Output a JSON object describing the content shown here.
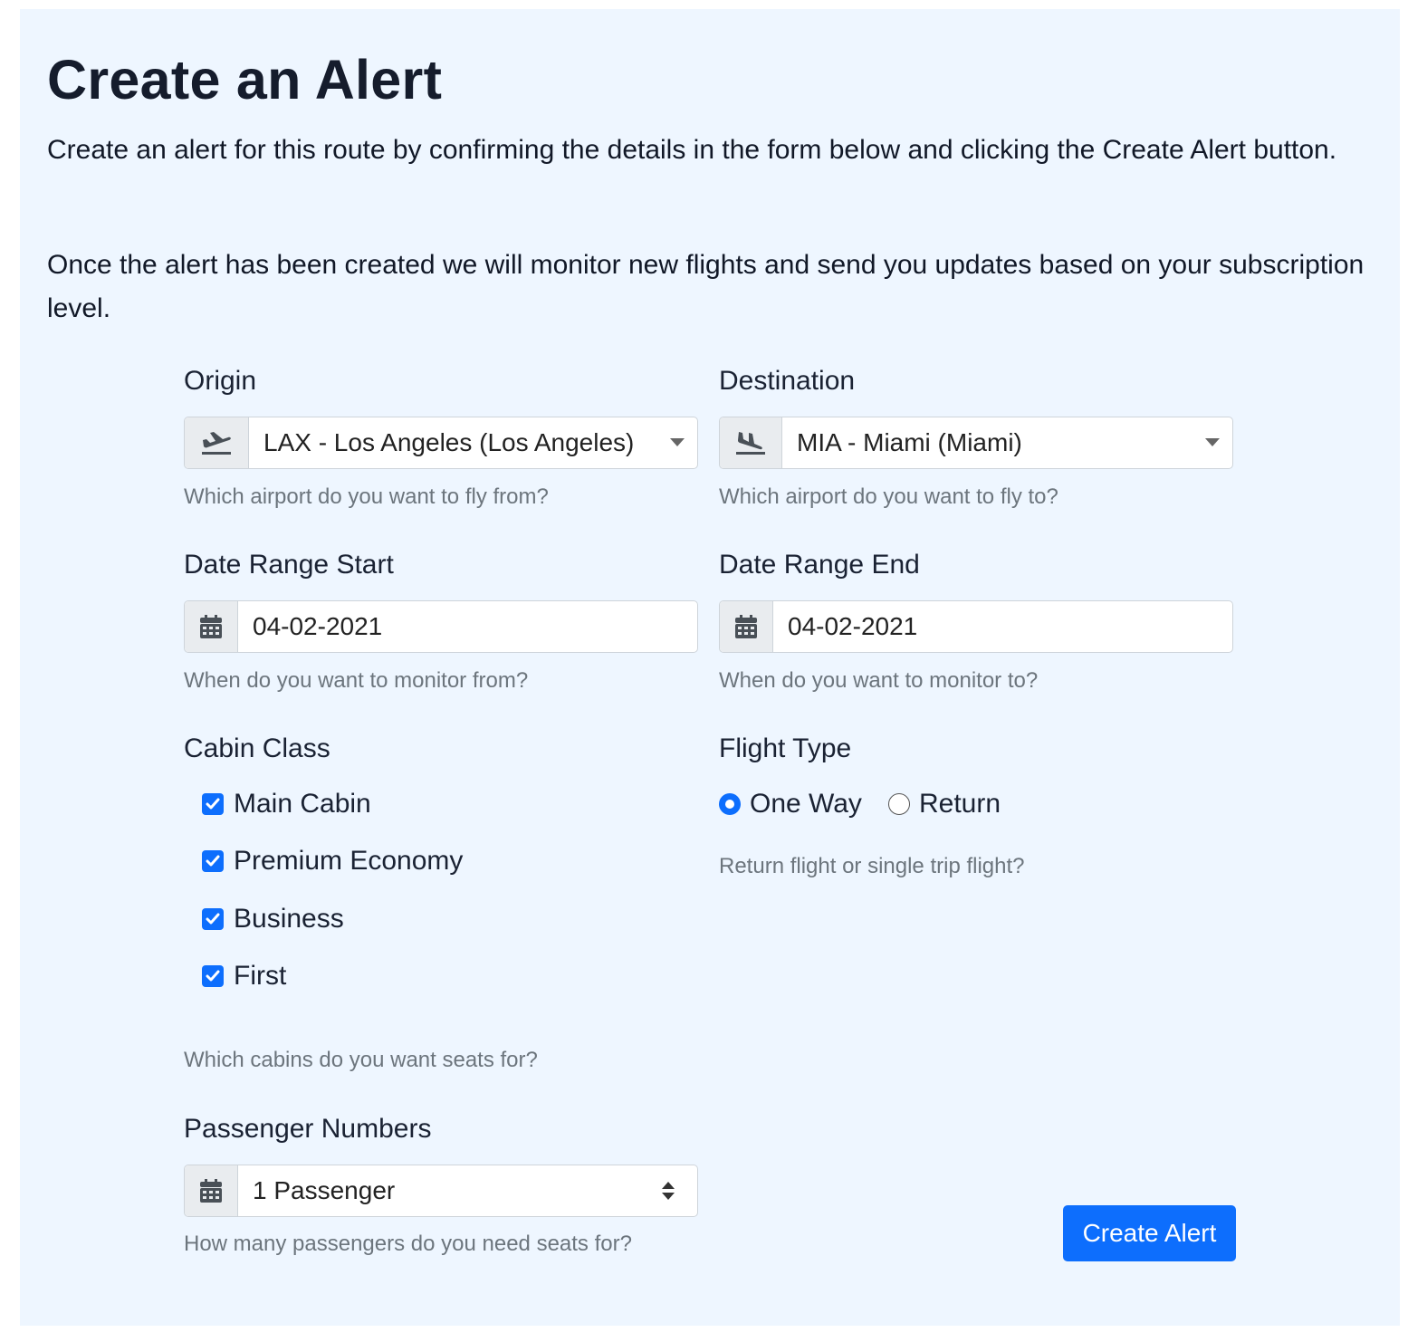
{
  "page": {
    "title": "Create an Alert",
    "intro_1": "Create an alert for this route by confirming the details in the form below and clicking the Create Alert button.",
    "intro_2": "Once the alert has been created we will monitor new flights and send you updates based on your subscription level."
  },
  "origin": {
    "label": "Origin",
    "icon": "plane-departure-icon",
    "value": "LAX - Los Angeles (Los Angeles)",
    "help": "Which airport do you want to fly from?"
  },
  "destination": {
    "label": "Destination",
    "icon": "plane-arrival-icon",
    "value": "MIA - Miami (Miami)",
    "help": "Which airport do you want to fly to?"
  },
  "date_start": {
    "label": "Date Range Start",
    "icon": "calendar-icon",
    "value": "04-02-2021",
    "help": "When do you want to monitor from?"
  },
  "date_end": {
    "label": "Date Range End",
    "icon": "calendar-icon",
    "value": "04-02-2021",
    "help": "When do you want to monitor to?"
  },
  "cabin_class": {
    "label": "Cabin Class",
    "options": [
      {
        "label": "Main Cabin",
        "checked": true
      },
      {
        "label": "Premium Economy",
        "checked": true
      },
      {
        "label": "Business",
        "checked": true
      },
      {
        "label": "First",
        "checked": true
      }
    ],
    "help": "Which cabins do you want seats for?"
  },
  "flight_type": {
    "label": "Flight Type",
    "options": [
      {
        "label": "One Way",
        "selected": true
      },
      {
        "label": "Return",
        "selected": false
      }
    ],
    "help": "Return flight or single trip flight?"
  },
  "passengers": {
    "label": "Passenger Numbers",
    "icon": "calendar-icon",
    "value": "1 Passenger",
    "help": "How many passengers do you need seats for?"
  },
  "submit": {
    "label": "Create Alert"
  },
  "colors": {
    "accent": "#0d6efd",
    "panel_bg": "#eef6ff",
    "help_text": "#6c757d"
  }
}
